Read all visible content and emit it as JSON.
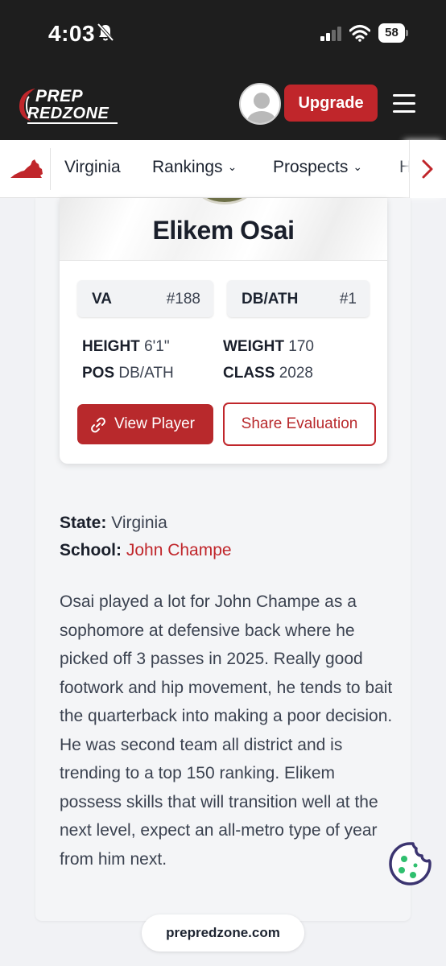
{
  "status_bar": {
    "time": "4:03",
    "battery": "58"
  },
  "header": {
    "logo_line1": "PREP",
    "logo_line2": "REDZONE",
    "upgrade_label": "Upgrade"
  },
  "nav": {
    "items": [
      {
        "label": "Virginia",
        "has_dropdown": false
      },
      {
        "label": "Rankings",
        "has_dropdown": true
      },
      {
        "label": "Prospects",
        "has_dropdown": true
      },
      {
        "label": "H",
        "has_dropdown": false
      }
    ],
    "chevron": "⌄"
  },
  "player_card": {
    "name": "Elikem Osai",
    "state_rank": {
      "label": "VA",
      "value": "#188"
    },
    "position_rank": {
      "label": "DB/ATH",
      "value": "#1"
    },
    "height": {
      "label": "HEIGHT",
      "value": "6'1\""
    },
    "weight": {
      "label": "WEIGHT",
      "value": "170"
    },
    "pos": {
      "label": "POS",
      "value": "DB/ATH"
    },
    "class": {
      "label": "CLASS",
      "value": "2028"
    },
    "view_button": "View Player",
    "share_button": "Share Evaluation"
  },
  "info": {
    "state_label": "State:",
    "state_value": "Virginia",
    "school_label": "School:",
    "school_value": "John Champe"
  },
  "description": "Osai played a lot for John Champe as a sophomore at defensive back where he picked off 3 passes in 2025. Really good footwork and hip movement, he tends to bait the quarterback into making a poor decision. He was second team all district and is trending to a top 150 ranking. Elikem possess skills that will transition well at the next level, expect an all-metro type of year from him next.",
  "url": "prepredzone.com",
  "colors": {
    "accent": "#c0262b",
    "dark": "#1e1e1e"
  }
}
